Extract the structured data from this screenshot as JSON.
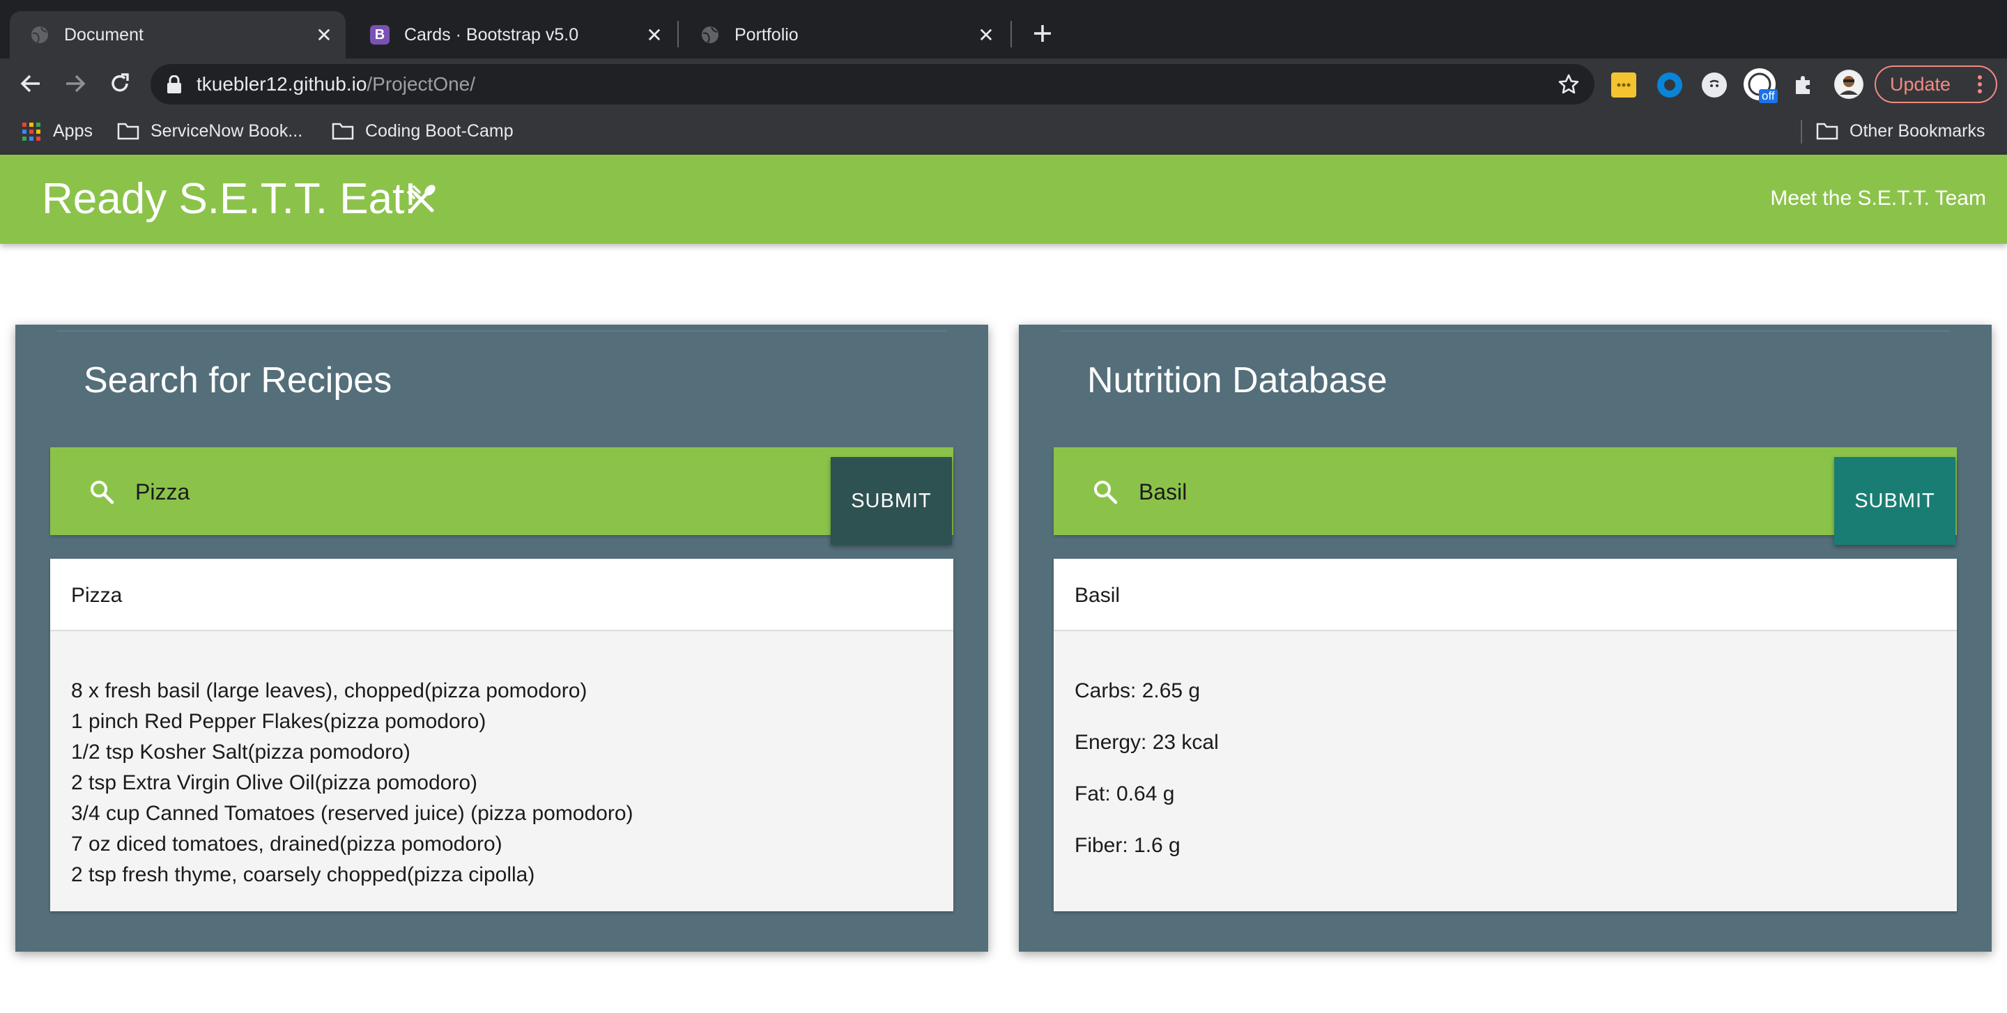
{
  "browser": {
    "tabs": [
      {
        "title": "Document",
        "active": true,
        "icon": "globe-icon"
      },
      {
        "title": "Cards · Bootstrap v5.0",
        "active": false,
        "icon": "bootstrap-icon",
        "icon_letter": "B"
      },
      {
        "title": "Portfolio",
        "active": false,
        "icon": "globe-icon"
      }
    ],
    "close_glyph": "✕",
    "new_tab_icon": "plus-icon",
    "url_host": "tkuebler12.github.io",
    "url_path": "/ProjectOne/",
    "update_label": "Update",
    "extension_badge": "off",
    "bookmarks": [
      {
        "label": "Apps",
        "icon": "apps-grid-icon"
      },
      {
        "label": "ServiceNow Book...",
        "icon": "folder-icon"
      },
      {
        "label": "Coding Boot-Camp",
        "icon": "folder-icon"
      }
    ],
    "other_bookmarks": "Other Bookmarks"
  },
  "navbar": {
    "brand": "Ready S.E.T.T. Eat!",
    "brand_icon": "utensils-icon",
    "team_link": "Meet the S.E.T.T. Team"
  },
  "recipes": {
    "title": "Search for Recipes",
    "search_value": "Pizza",
    "submit_label": "SUBMIT",
    "result_title": "Pizza",
    "ingredients": [
      "8 x fresh basil (large leaves), chopped(pizza pomodoro)",
      "1 pinch Red Pepper Flakes(pizza pomodoro)",
      "1/2 tsp Kosher Salt(pizza pomodoro)",
      "2 tsp Extra Virgin Olive Oil(pizza pomodoro)",
      "3/4 cup Canned Tomatoes (reserved juice) (pizza pomodoro)",
      "7 oz diced tomatoes, drained(pizza pomodoro)",
      "2 tsp fresh thyme, coarsely chopped(pizza cipolla)"
    ]
  },
  "nutrition": {
    "title": "Nutrition Database",
    "search_value": "Basil",
    "submit_label": "SUBMIT",
    "result_title": "Basil",
    "facts": [
      "Carbs: 2.65 g",
      "Energy: 23 kcal",
      "Fat: 0.64 g",
      "Fiber: 1.6 g"
    ]
  },
  "colors": {
    "accent_green": "#8bc34a",
    "panel_slate": "#546e7a",
    "recipe_submit": "#2e5151",
    "nutrition_submit": "#1a7d73"
  }
}
